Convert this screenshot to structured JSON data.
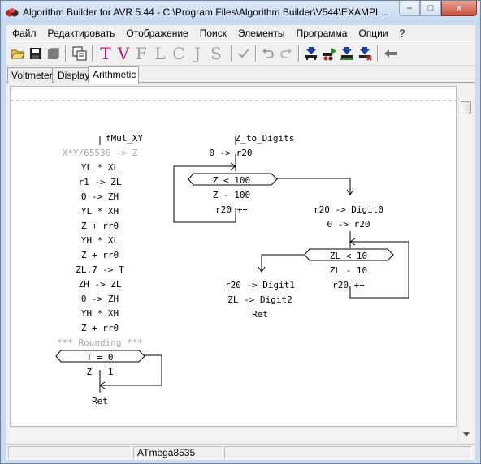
{
  "window": {
    "title": "Algorithm Builder for AVR 5.44 - C:\\Program Files\\Algorithm Builder\\V544\\EXAMPL...",
    "minimize": "–",
    "maximize": "□",
    "close": "✕"
  },
  "menu": [
    "Файл",
    "Редактировать",
    "Отображение",
    "Поиск",
    "Элементы",
    "Программа",
    "Опции",
    "?"
  ],
  "toolbar": {
    "letters": [
      "T",
      "V",
      "F",
      "L",
      "C",
      "J",
      "S"
    ],
    "icons": [
      "open-folder-icon",
      "save-icon",
      "save-all-icon",
      "copy-window-icon",
      "checkmark-icon",
      "undo-icon",
      "redo-icon",
      "compile-icon",
      "run-chip-icon",
      "program-chip-icon",
      "erase-chip-icon",
      "back-arrow-icon"
    ],
    "letter_colors": {
      "active": "#c0157a",
      "inactive": "#a0a0a0"
    }
  },
  "tabs": [
    {
      "label": "Voltmeter",
      "active": false
    },
    {
      "label": "Display",
      "active": false
    },
    {
      "label": "Arithmetic",
      "active": true
    }
  ],
  "diagram": {
    "left": {
      "label": "fMul_XY",
      "comment": "X*Y/65536 -> Z",
      "ops": [
        "YL * XL",
        "r1 -> ZL",
        "0 -> ZH",
        "YL * XH",
        "Z + rr0",
        "YH * XL",
        "Z + rr0",
        "ZL.7 -> T",
        "ZH -> ZL",
        "0 -> ZH",
        "YH * XH",
        "Z + rr0"
      ],
      "rounding_comment": "*** Rounding ***",
      "cond": "T = 0",
      "after": "Z + 1",
      "ret": "Ret"
    },
    "middle": {
      "label": "Z_to_Digits",
      "first": "0 -> r20",
      "cond": "Z < 100",
      "ops": [
        "Z - 100",
        "r20 ++"
      ]
    },
    "right": {
      "ops_top": [
        "r20 -> Digit0",
        "0 -> r20"
      ],
      "cond": "ZL < 10",
      "ops": [
        "ZL - 10",
        "r20 ++"
      ],
      "branch": [
        "r20 -> Digit1",
        "ZL -> Digit2",
        "Ret"
      ]
    }
  },
  "status": {
    "chip": "ATmega8535"
  }
}
